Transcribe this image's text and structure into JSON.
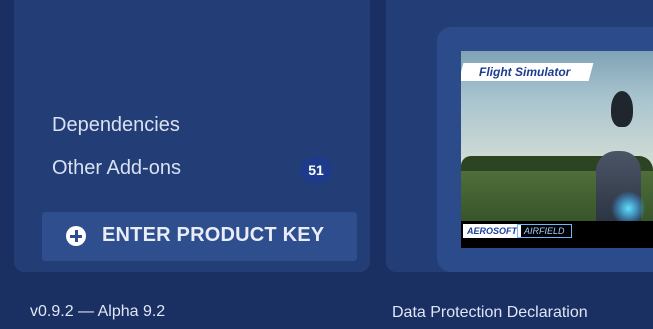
{
  "sidebar": {
    "items": [
      {
        "label": "Dependencies"
      },
      {
        "label": "Other Add-ons",
        "badge": "51"
      }
    ],
    "enter_key_button": {
      "label": "ENTER PRODUCT KEY",
      "icon": "plus-circle-icon"
    }
  },
  "product_card": {
    "logo_text": "Flight Simulator",
    "brand_left": "AEROSOFT",
    "brand_right": "AIRFIELD"
  },
  "footer": {
    "version": "v0.9.2 — Alpha 9.2",
    "link": "Data Protection Declaration"
  },
  "colors": {
    "background": "#1a2f62",
    "panel": "#233d76",
    "button": "#2e4e8e",
    "badge": "#1d3b8a"
  }
}
